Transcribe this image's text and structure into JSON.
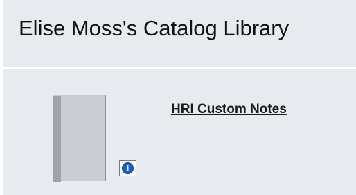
{
  "library": {
    "title": "Elise Moss's Catalog Library"
  },
  "items": [
    {
      "title": "HRI Custom Notes",
      "thumbnail_icon": "book-icon",
      "info_icon": "info-icon",
      "info_symbol": "i"
    }
  ],
  "colors": {
    "panel_background": "#e7ebef",
    "info_blue": "#1a5fd0",
    "book_cover": "#c9ccd1"
  }
}
